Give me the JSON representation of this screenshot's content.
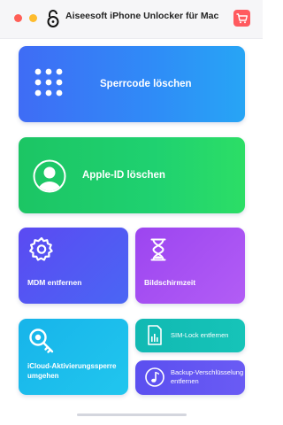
{
  "window": {
    "title": "Aiseesoft iPhone Unlocker für Mac"
  },
  "toolbar": {
    "cart_icon": "shopping-cart-icon",
    "app_icon": "padlock-icon"
  },
  "cards": {
    "passcode": {
      "label": "Sperrcode löschen",
      "icon": "keypad-icon"
    },
    "appleid": {
      "label": "Apple-ID löschen",
      "icon": "user-silhouette-icon"
    },
    "mdm": {
      "label": "MDM entfernen",
      "icon": "gear-icon"
    },
    "screentime": {
      "label": "Bildschirmzeit",
      "icon": "hourglass-icon"
    },
    "icloud": {
      "label": "iCloud-Aktivierungssperre umgehen",
      "icon": "magnifier-key-icon"
    },
    "simlock": {
      "label": "SIM-Lock entfernen",
      "icon": "sim-card-icon"
    },
    "backup": {
      "label": "Backup-Verschlüsselung entfernen",
      "icon": "music-note-icon"
    }
  },
  "colors": {
    "passcode": "#3f6cf5",
    "appleid": "#1fd170",
    "mdm": "#4f5af3",
    "screentime": "#a650f2",
    "icloud": "#1cbdec",
    "simlock": "#14bfb6",
    "backup": "#6255f2",
    "cart": "#ff5a5f"
  }
}
